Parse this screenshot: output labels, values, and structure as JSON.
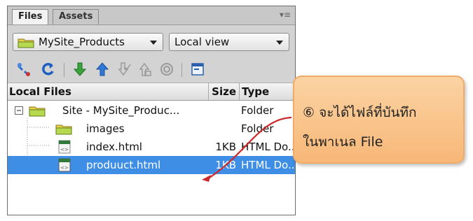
{
  "tabs": {
    "files": "Files",
    "assets": "Assets"
  },
  "site_dropdown": {
    "value": "MySite_Products",
    "icon": "folder-icon"
  },
  "view_dropdown": {
    "value": "Local view"
  },
  "toolbar": {
    "icons": [
      "connect-icon",
      "refresh-icon",
      "get-files-icon",
      "put-files-icon",
      "check-out-icon",
      "check-in-icon",
      "sync-icon",
      "expand-icon"
    ]
  },
  "columns": {
    "local": "Local Files",
    "size": "Size",
    "type": "Type"
  },
  "files": [
    {
      "name": "Site - MySite_Produc...",
      "size": "",
      "type": "Folder",
      "kind": "site"
    },
    {
      "name": "images",
      "size": "",
      "type": "Folder",
      "kind": "folder"
    },
    {
      "name": "index.html",
      "size": "1KB",
      "type": "HTML Do...",
      "kind": "html"
    },
    {
      "name": "produuct.html",
      "size": "1KB",
      "type": "HTML Do...",
      "kind": "html",
      "selected": true
    }
  ],
  "callout": {
    "line1": "⑥ จะได้ไฟล์ที่บันทึก",
    "line2": "ในพาเนล File"
  },
  "colors": {
    "selection": "#3f8ee6",
    "callout_fill": "#f7b878",
    "arrow": "#cc2a2a"
  }
}
